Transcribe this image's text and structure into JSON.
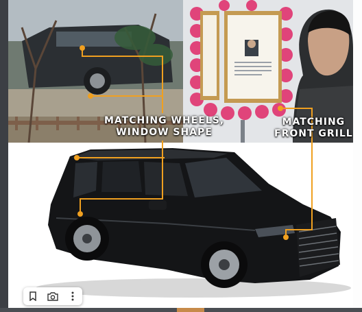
{
  "captions": {
    "left_line1": "MATCHING WHEELS,",
    "left_line2": "WINDOW SHAPE",
    "right_line1": "MATCHING",
    "right_line2": "FRONT GRILL"
  },
  "toolbar": {
    "bookmark_icon": "bookmark-icon",
    "camera_icon": "camera-icon",
    "more_icon": "more-vertical-icon"
  },
  "colors": {
    "callout": "#f0a020",
    "car_body": "#141517",
    "frame_bg": "#ffffff"
  }
}
